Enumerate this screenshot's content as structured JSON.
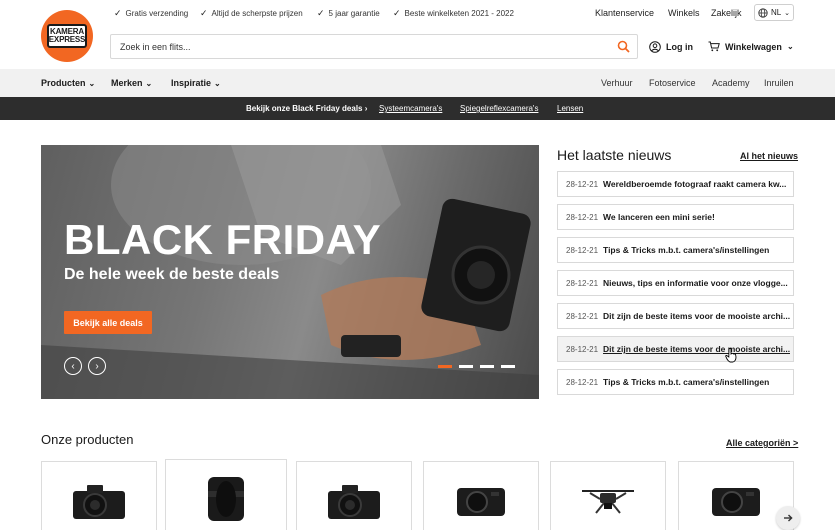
{
  "brand": {
    "logo_line1": "KAMERA",
    "logo_line2": "EXPRESS",
    "accent": "#f26722"
  },
  "usps": [
    "Gratis verzending",
    "Altijd de scherpste prijzen",
    "5 jaar garantie",
    "Beste winkelketen 2021 - 2022"
  ],
  "top_links": {
    "service": "Klantenservice",
    "stores": "Winkels",
    "business": "Zakelijk",
    "language": "NL"
  },
  "search": {
    "placeholder": "Zoek in een flits..."
  },
  "account": {
    "login": "Log in",
    "cart": "Winkelwagen"
  },
  "nav": {
    "left": [
      "Producten",
      "Merken",
      "Inspiratie"
    ],
    "right": [
      "Verhuur",
      "Fotoservice",
      "Academy",
      "Inruilen"
    ]
  },
  "promo": {
    "deals": "Bekijk onze Black Friday deals",
    "links": [
      "Systeemcamera's",
      "Spiegelreflexcamera's",
      "Lensen"
    ]
  },
  "hero": {
    "title": "BLACK FRIDAY",
    "subtitle": "De hele week de beste deals",
    "button": "Bekijk alle deals",
    "active_slide": 1,
    "slide_count": 4
  },
  "news": {
    "heading": "Het laatste nieuws",
    "all_link": "Al het nieuws",
    "items": [
      {
        "date": "28-12-21",
        "title": "Wereldberoemde fotograaf raakt camera kw..."
      },
      {
        "date": "28-12-21",
        "title": "We lanceren een mini serie!"
      },
      {
        "date": "28-12-21",
        "title": "Tips & Tricks m.b.t. camera's/instellingen"
      },
      {
        "date": "28-12-21",
        "title": "Nieuws, tips en informatie voor onze vlogge..."
      },
      {
        "date": "28-12-21",
        "title": "Dit zijn de beste items voor de mooiste archi..."
      },
      {
        "date": "28-12-21",
        "title": "Dit zijn de beste items voor de mooiste archi..."
      },
      {
        "date": "28-12-21",
        "title": "Tips & Tricks m.b.t. camera's/instellingen"
      }
    ]
  },
  "products": {
    "heading": "Onze producten",
    "all_link": "Alle categoriën >"
  }
}
